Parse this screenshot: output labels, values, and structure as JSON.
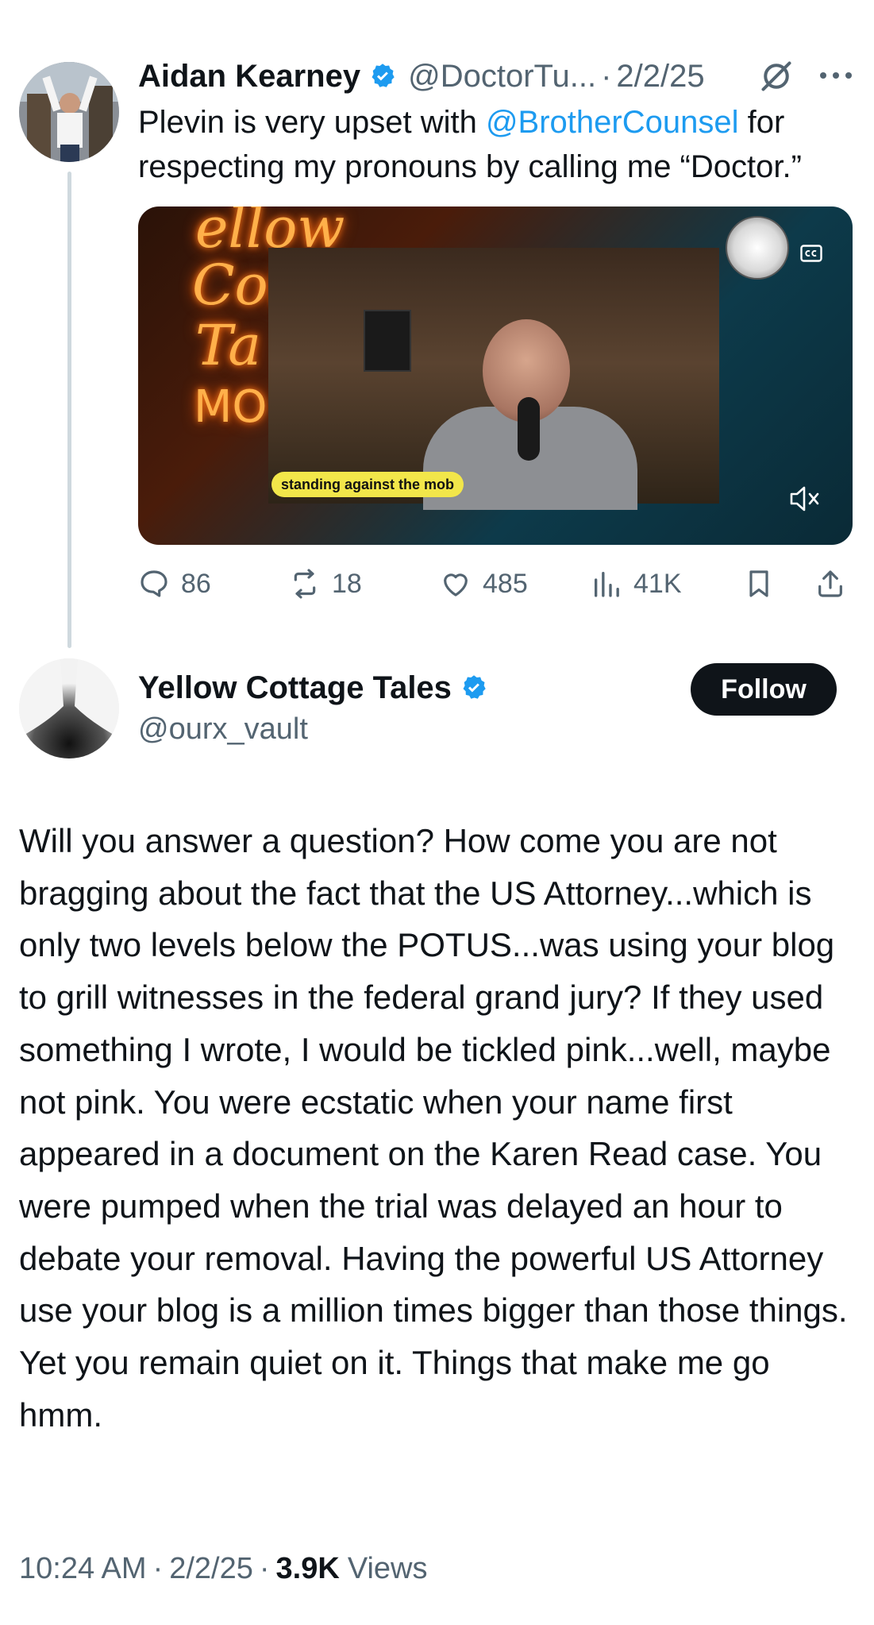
{
  "colors": {
    "accent": "#1d9bf0",
    "muted": "#536471",
    "text": "#0f1419",
    "button_bg": "#0f1419"
  },
  "parent_tweet": {
    "author_name": "Aidan Kearney",
    "handle": "@DoctorTu...",
    "separator": "·",
    "date": "2/2/25",
    "text_before": "Plevin is very upset with ",
    "mention": "@BrotherCounsel",
    "text_after": " for respecting my pronouns by calling me “Doctor.”",
    "media": {
      "caption": "standing against the mob",
      "neon_lines": [
        "ellow",
        "Cot",
        "Ta",
        "MO"
      ],
      "icons": [
        "closed-caption-icon",
        "muted-speaker-icon"
      ]
    },
    "stats": {
      "replies": "86",
      "reposts": "18",
      "likes": "485",
      "views": "41K"
    },
    "icons": [
      "verified-badge-icon",
      "grok-icon",
      "more-icon",
      "reply-icon",
      "repost-icon",
      "like-icon",
      "views-icon",
      "bookmark-icon",
      "share-icon"
    ]
  },
  "reply_tweet": {
    "author_name": "Yellow Cottage Tales",
    "handle": "@ourx_vault",
    "follow_label": "Follow",
    "body": "Will you answer a question? How come you are not bragging about the fact that the US Attorney...which is only two levels below the POTUS...was using your blog to grill witnesses in the federal grand jury? If they used something I wrote, I would be tickled pink...well, maybe not pink. You were ecstatic when your name first appeared in a document on the Karen Read case. You were pumped when the trial was delayed an hour to debate your removal. Having the powerful US Attorney use your blog is a million times bigger than those things. Yet you remain quiet on it. Things that make me go hmm.",
    "time": "10:24 AM",
    "date": "2/2/25",
    "views_count": "3.9K",
    "views_label": "Views",
    "separator": "·"
  }
}
